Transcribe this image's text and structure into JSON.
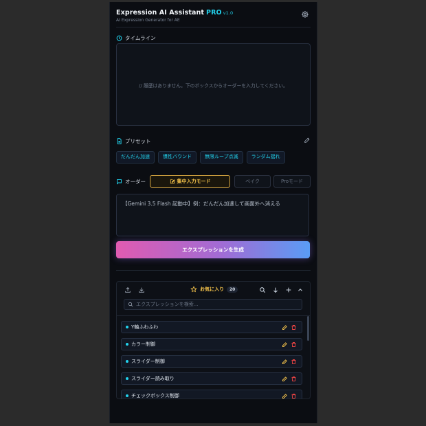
{
  "header": {
    "title": "Expression AI Assistant",
    "pro": "PRO",
    "version": "v1.0",
    "subtitle": "AI Expression Generator for AE"
  },
  "timeline": {
    "label": "タイムライン",
    "empty_text": "// 履歴はありません。下のボックスからオーダーを入力してください。"
  },
  "presets": {
    "label": "プリセット",
    "items": [
      "だんだん加速",
      "慣性バウンド",
      "無限ループ点滅",
      "ランダム揺れ"
    ]
  },
  "order": {
    "label": "オーダー",
    "focus_mode": "集中入力モード",
    "bake": "ベイク",
    "pro_mode": "Proモード",
    "input_value": "【Gemini 3.5 Flash 起動中】例：だんだん加速して画面外へ消える"
  },
  "generate_button": "エクスプレッションを生成",
  "favorites": {
    "title": "お気に入り",
    "count": "20",
    "search_placeholder": "エクスプレッションを検索...",
    "items": [
      "Y軸ふわふわ",
      "カラー制御",
      "スライダー制御",
      "スライダー読み取り",
      "チェックボックス制御"
    ]
  },
  "colors": {
    "accent_cyan": "#22d3ee",
    "accent_gold": "#f5c34b",
    "delete_red": "#ef4444",
    "gradient_start": "#e05bb1",
    "gradient_end": "#5a9cf5"
  }
}
